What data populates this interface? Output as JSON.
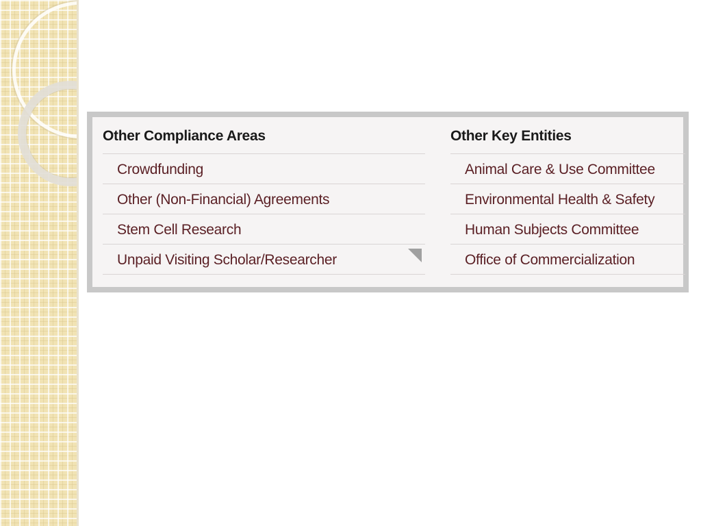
{
  "compliance": {
    "heading": "Other Compliance Areas",
    "items": [
      {
        "label": "Crowdfunding"
      },
      {
        "label": "Other (Non-Financial) Agreements"
      },
      {
        "label": "Stem Cell Research"
      },
      {
        "label": "Unpaid Visiting Scholar/Researcher"
      }
    ]
  },
  "entities": {
    "heading": "Other Key Entities",
    "items": [
      {
        "label": "Animal Care & Use Committee"
      },
      {
        "label": "Environmental Health & Safety"
      },
      {
        "label": "Human Subjects Committee"
      },
      {
        "label": "Office of Commercialization"
      }
    ]
  },
  "colors": {
    "link": "#5a1f24",
    "heading": "#1a1a1a",
    "panel_border": "#c8c8c8",
    "panel_bg": "#f6f4f4",
    "side_strip": "#f1e3b4"
  }
}
